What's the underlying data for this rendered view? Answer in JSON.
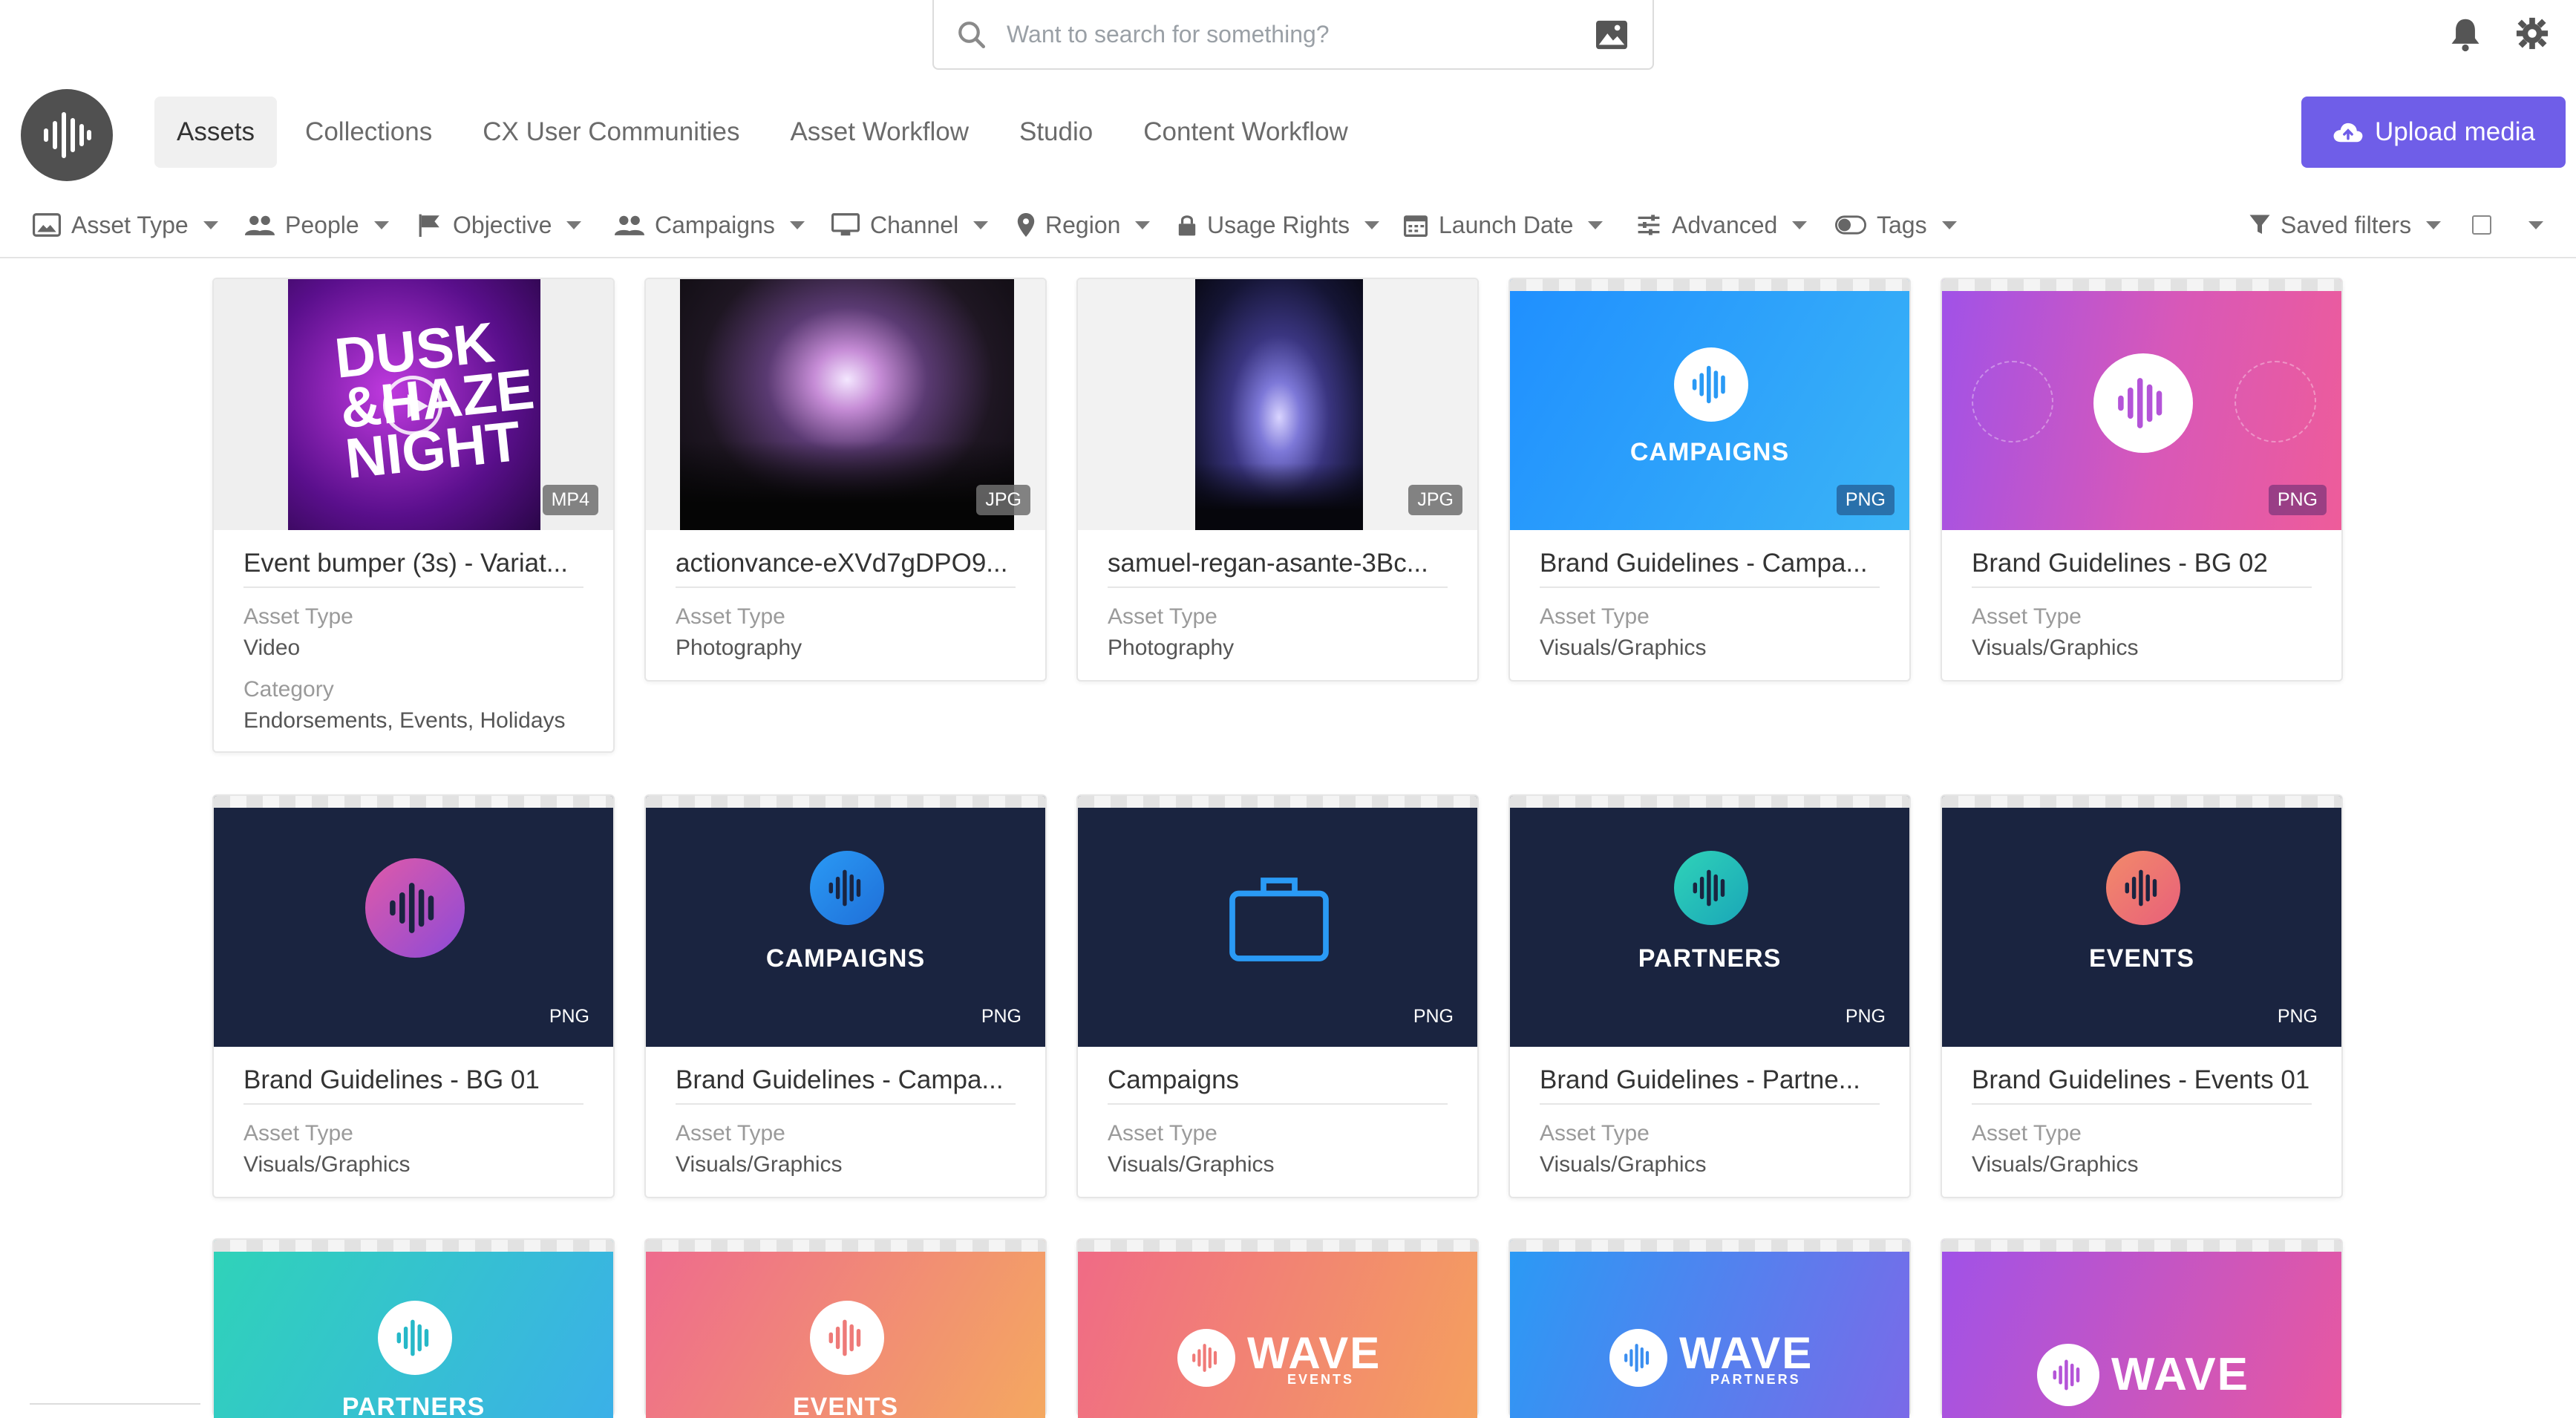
{
  "search": {
    "placeholder": "Want to search for something?"
  },
  "nav": {
    "tabs": [
      "Assets",
      "Collections",
      "CX User Communities",
      "Asset Workflow",
      "Studio",
      "Content Workflow"
    ],
    "upload": "Upload media"
  },
  "filters": [
    "Asset Type",
    "People",
    "Objective",
    "Campaigns",
    "Channel",
    "Region",
    "Usage Rights",
    "Launch Date",
    "Advanced",
    "Tags"
  ],
  "saved_filters": "Saved filters",
  "colors": {
    "accent": "#6f5ee8",
    "navy": "#1a2440"
  },
  "cards": [
    {
      "name": "Event bumper (3s) - Variat...",
      "badge": "MP4",
      "label1": "Asset Type",
      "value1": "Video",
      "label2": "Category",
      "value2": "Endorsements, Events, Holidays",
      "art": [
        "DUSK",
        "&HAZE",
        "NIGHT"
      ]
    },
    {
      "name": "actionvance-eXVd7gDPO9...",
      "badge": "JPG",
      "label1": "Asset Type",
      "value1": "Photography"
    },
    {
      "name": "samuel-regan-asante-3Bc...",
      "badge": "JPG",
      "label1": "Asset Type",
      "value1": "Photography"
    },
    {
      "name": "Brand Guidelines - Campa...",
      "badge": "PNG",
      "label1": "Asset Type",
      "value1": "Visuals/Graphics",
      "art": "CAMPAIGNS"
    },
    {
      "name": "Brand Guidelines - BG 02",
      "badge": "PNG",
      "label1": "Asset Type",
      "value1": "Visuals/Graphics"
    },
    {
      "name": "Brand Guidelines - BG 01",
      "badge": "PNG",
      "label1": "Asset Type",
      "value1": "Visuals/Graphics"
    },
    {
      "name": "Brand Guidelines - Campa...",
      "badge": "PNG",
      "label1": "Asset Type",
      "value1": "Visuals/Graphics",
      "art": "CAMPAIGNS"
    },
    {
      "name": "Campaigns",
      "badge": "PNG",
      "label1": "Asset Type",
      "value1": "Visuals/Graphics"
    },
    {
      "name": "Brand Guidelines - Partne...",
      "badge": "PNG",
      "label1": "Asset Type",
      "value1": "Visuals/Graphics",
      "art": "PARTNERS"
    },
    {
      "name": "Brand Guidelines - Events 01",
      "badge": "PNG",
      "label1": "Asset Type",
      "value1": "Visuals/Graphics",
      "art": "EVENTS"
    }
  ],
  "row3": [
    {
      "art": "PARTNERS"
    },
    {
      "art": "EVENTS"
    },
    {
      "art": "WAVE",
      "sub": "EVENTS"
    },
    {
      "art": "WAVE",
      "sub": "PARTNERS"
    },
    {
      "art": "WAVE"
    }
  ]
}
